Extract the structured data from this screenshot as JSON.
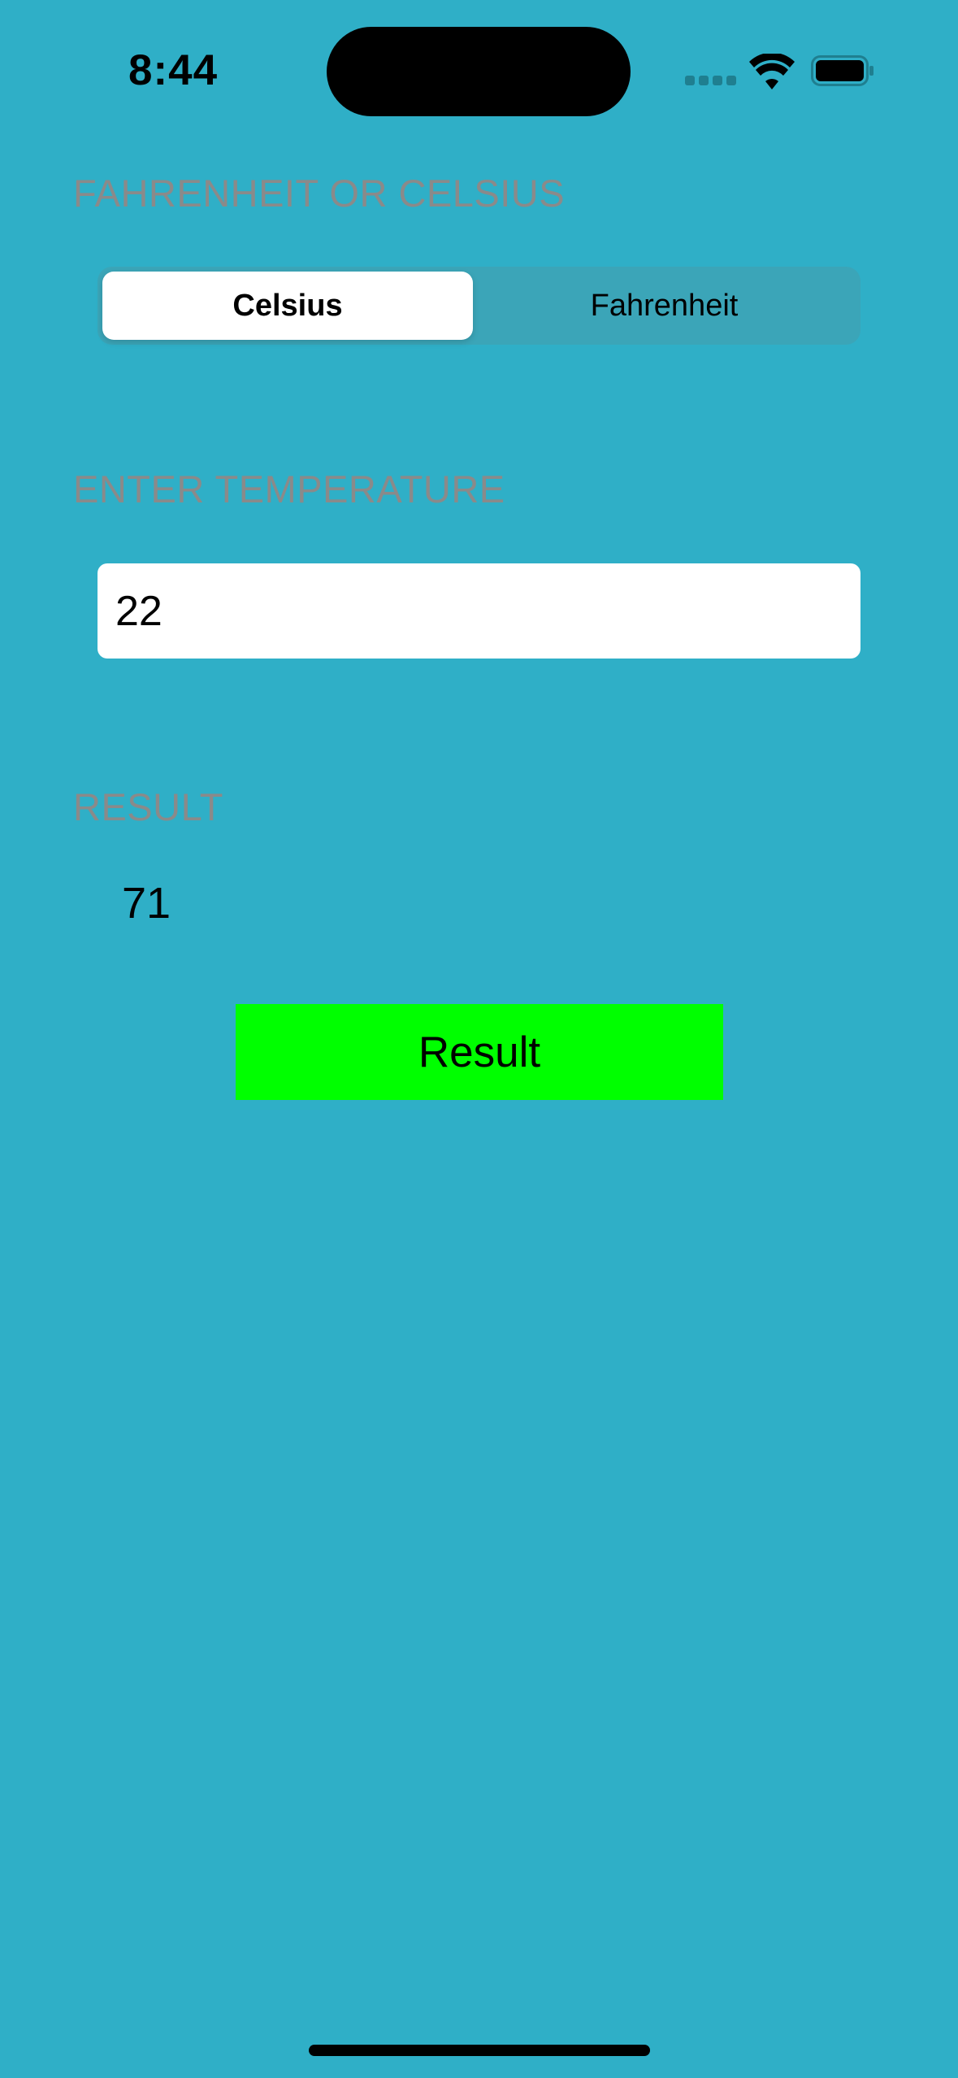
{
  "status_bar": {
    "time": "8:44"
  },
  "unit_section": {
    "label": "FAHRENHEIT OR CELSIUS",
    "options": [
      "Celsius",
      "Fahrenheit"
    ],
    "selected": "Celsius"
  },
  "input_section": {
    "label": "ENTER TEMPERATURE",
    "value": "22"
  },
  "result_section": {
    "label": "RESULT",
    "value": "71"
  },
  "result_button": {
    "label": "Result"
  },
  "colors": {
    "background": "#2fafc7",
    "label_gray": "#8a8a8a",
    "button_green": "#00ff00"
  },
  "icons": {
    "signal": "cellular-signal-icon",
    "wifi": "wifi-icon",
    "battery": "battery-icon"
  }
}
